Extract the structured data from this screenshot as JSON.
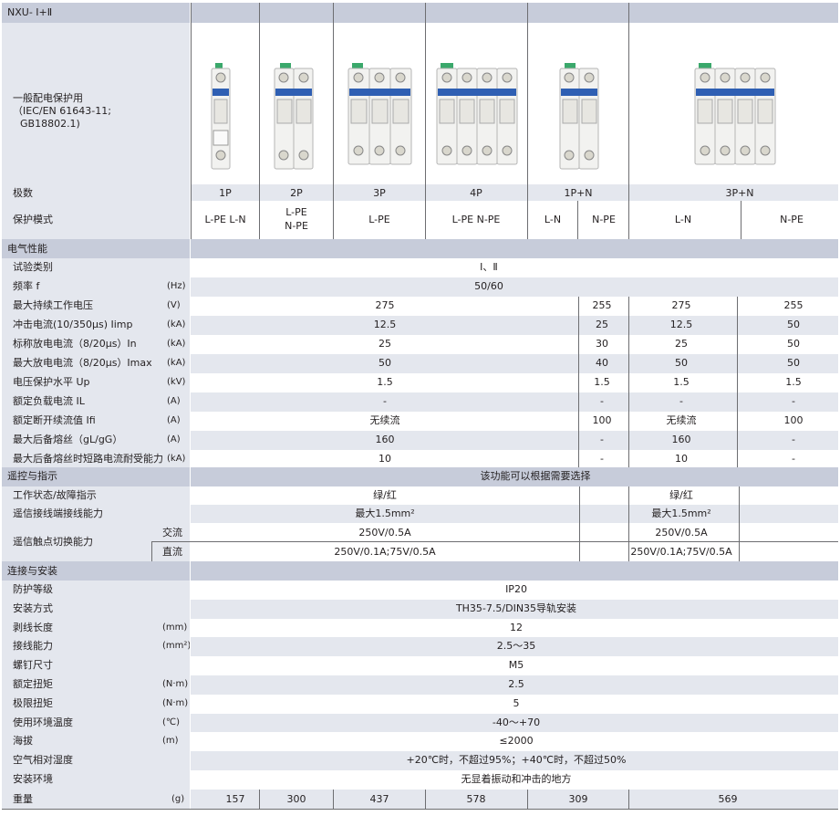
{
  "product": {
    "model": "NXU- Ⅰ+Ⅱ",
    "application": [
      "一般配电保护用",
      "（IEC/EN 61643-11;",
      "GB18802.1)"
    ]
  },
  "header": {
    "poles_label": "极数",
    "poles": [
      "1P",
      "2P",
      "3P",
      "4P",
      "1P+N",
      "3P+N"
    ],
    "mode_label": "保护模式",
    "modes": [
      "L-PE L-N",
      "L-PE",
      "N-PE",
      "L-PE",
      "L-PE N-PE",
      "L-N",
      "N-PE",
      "L-N",
      "N-PE"
    ]
  },
  "electrical": {
    "title": "电气性能",
    "rows": [
      {
        "label": "试验类别",
        "unit": "",
        "values": [
          "Ⅰ、Ⅱ"
        ]
      },
      {
        "label": "频率 f",
        "unit": "(Hz)",
        "values": [
          "50/60"
        ]
      },
      {
        "label": "最大持续工作电压",
        "unit": "(V)",
        "values": [
          "275",
          "255",
          "275",
          "255"
        ]
      },
      {
        "label": "冲击电流(10/350μs)  Iimp",
        "unit": "(kA)",
        "values": [
          "12.5",
          "25",
          "12.5",
          "50"
        ]
      },
      {
        "label": "标称放电电流（8/20μs）In",
        "unit": "(kA)",
        "values": [
          "25",
          "30",
          "25",
          "50"
        ]
      },
      {
        "label": "最大放电电流（8/20μs）Imax",
        "unit": "(kA)",
        "values": [
          "50",
          "40",
          "50",
          "50"
        ]
      },
      {
        "label": "电压保护水平 Up",
        "unit": "(kV)",
        "values": [
          "1.5",
          "1.5",
          "1.5",
          "1.5"
        ]
      },
      {
        "label": "额定负载电流 IL",
        "unit": "(A)",
        "values": [
          "-",
          "-",
          "-",
          "-"
        ]
      },
      {
        "label": "额定断开续流值 Ifi",
        "unit": "(A)",
        "values": [
          "无续流",
          "100",
          "无续流",
          "100"
        ]
      },
      {
        "label": "最大后备熔丝（gL/gG）",
        "unit": "(A)",
        "values": [
          "160",
          "-",
          "160",
          "-"
        ]
      },
      {
        "label": "最大后备熔丝时短路电流耐受能力",
        "unit": "(kA)",
        "values": [
          "10",
          "-",
          "10",
          "-"
        ]
      }
    ]
  },
  "remote": {
    "title": "遥控与指示",
    "note": "该功能可以根据需要选择",
    "status_label": "工作状态/故障指示",
    "status_values": [
      "绿/红",
      "绿/红"
    ],
    "wiring_label": "遥信接线端接线能力",
    "wiring_values": [
      "最大1.5mm²",
      "最大1.5mm²"
    ],
    "switch_label": "遥信触点切换能力",
    "ac_label": "交流",
    "ac_values": [
      "250V/0.5A",
      "250V/0.5A"
    ],
    "dc_label": "直流",
    "dc_values": [
      "250V/0.1A;75V/0.5A",
      "250V/0.1A;75V/0.5A"
    ]
  },
  "install": {
    "title": "连接与安装",
    "rows": [
      {
        "label": "防护等级",
        "unit": "",
        "value": "IP20"
      },
      {
        "label": "安装方式",
        "unit": "",
        "value": "TH35-7.5/DIN35导轨安装"
      },
      {
        "label": "剥线长度",
        "unit": "(mm)",
        "value": "12"
      },
      {
        "label": "接线能力",
        "unit": "(mm²)",
        "value": "2.5～35"
      },
      {
        "label": "螺钉尺寸",
        "unit": "",
        "value": "M5"
      },
      {
        "label": "额定扭矩",
        "unit": "(N·m)",
        "value": "2.5"
      },
      {
        "label": "极限扭矩",
        "unit": "(N·m)",
        "value": "5"
      },
      {
        "label": "使用环境温度",
        "unit": "(℃)",
        "value": "-40～+70"
      },
      {
        "label": "海拔",
        "unit": "(m)",
        "value": "≤2000"
      },
      {
        "label": "空气相对湿度",
        "unit": "",
        "value": "+20℃时，不超过95%；+40℃时，不超过50%"
      },
      {
        "label": "安装环境",
        "unit": "",
        "value": "无显着振动和冲击的地方"
      }
    ],
    "weight_label": "重量",
    "weight_unit": "(g)",
    "weights": [
      "157",
      "300",
      "437",
      "578",
      "309",
      "569"
    ]
  },
  "colors": {
    "header_band": "#c7ccda",
    "alt_band": "#e4e7ee",
    "text": "#231f20",
    "module": "#f2f2f0",
    "terminal_green": "#3aa86b",
    "label_blue": "#2f5fb3"
  }
}
